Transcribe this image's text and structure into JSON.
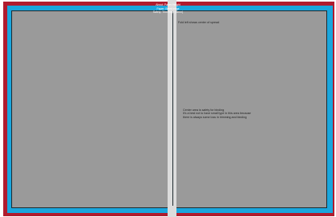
{
  "header": {
    "lines": [
      "About: Paper Height",
      "Paper: Bleed edge",
      "Safety: Trim edge (5mm)"
    ]
  },
  "annotations": {
    "gutter_note": "Fold left shows center of spread",
    "safe_note": [
      "Center area is safety for binding",
      "It's a best not to have small type in this area because",
      "there is always some loss in trimming and binding"
    ]
  },
  "colors": {
    "bleed": "#b01c2e",
    "trim": "#1aa6dd",
    "safe_area": "#9a9a9a",
    "gutter": "#dcdcdc",
    "line": "#1f2a30"
  }
}
